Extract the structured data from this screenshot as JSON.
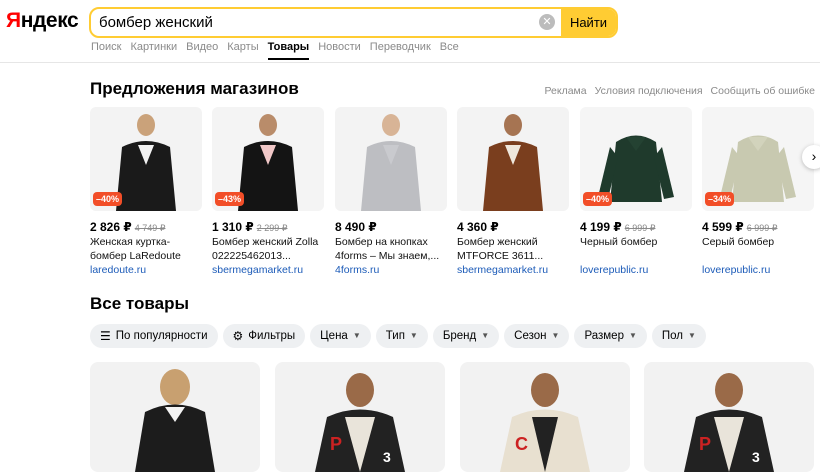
{
  "header": {
    "logo": "Яндекс",
    "search_value": "бомбер женский",
    "search_button": "Найти",
    "tabs": [
      "Поиск",
      "Картинки",
      "Видео",
      "Карты",
      "Товары",
      "Новости",
      "Переводчик",
      "Все"
    ],
    "active_tab": "Товары"
  },
  "shop_offers": {
    "title": "Предложения магазинов",
    "links": [
      "Реклама",
      "Условия подключения",
      "Сообщить об ошибке"
    ],
    "cards": [
      {
        "price": "2 826 ₽",
        "old_price": "4 749 ₽",
        "discount": "–40%",
        "title": "Женская куртка-бомбер LaRedoute",
        "shop": "laredoute.ru",
        "icon": "black-bomber-photo"
      },
      {
        "price": "1 310 ₽",
        "old_price": "2 299 ₽",
        "discount": "–43%",
        "title": "Бомбер женский Zolla 022225462013...",
        "shop": "sbermegamarket.ru",
        "icon": "pink-black-bomber-photo"
      },
      {
        "price": "8 490 ₽",
        "old_price": "",
        "discount": "",
        "title": "Бомбер на кнопках 4forms – Мы знаем,...",
        "shop": "4forms.ru",
        "icon": "grey-bomber-photo"
      },
      {
        "price": "4 360 ₽",
        "old_price": "",
        "discount": "",
        "title": "Бомбер женский MTFORCE 3611...",
        "shop": "sbermegamarket.ru",
        "icon": "brown-varsity-bomber-photo"
      },
      {
        "price": "4 199 ₽",
        "old_price": "6 999 ₽",
        "discount": "–40%",
        "title": "Черный бомбер",
        "shop": "loverepublic.ru",
        "icon": "dark-green-bomber-photo"
      },
      {
        "price": "4 599 ₽",
        "old_price": "6 999 ₽",
        "discount": "–34%",
        "title": "Серый бомбер",
        "shop": "loverepublic.ru",
        "icon": "sage-bomber-photo"
      }
    ]
  },
  "all_goods": {
    "title": "Все товары",
    "filters": [
      {
        "label": "По популярности",
        "icon": "sort-icon"
      },
      {
        "label": "Фильтры",
        "icon": "filters-icon"
      },
      {
        "label": "Цена",
        "icon": "chevron-down-icon"
      },
      {
        "label": "Тип",
        "icon": "chevron-down-icon"
      },
      {
        "label": "Бренд",
        "icon": "chevron-down-icon"
      },
      {
        "label": "Сезон",
        "icon": "chevron-down-icon"
      },
      {
        "label": "Размер",
        "icon": "chevron-down-icon"
      },
      {
        "label": "Пол",
        "icon": "chevron-down-icon"
      }
    ]
  },
  "colors": {
    "accent": "#ffcc33",
    "link": "#1c5bb8",
    "discount": "#f24e28",
    "logo_red": "#ff0000"
  }
}
